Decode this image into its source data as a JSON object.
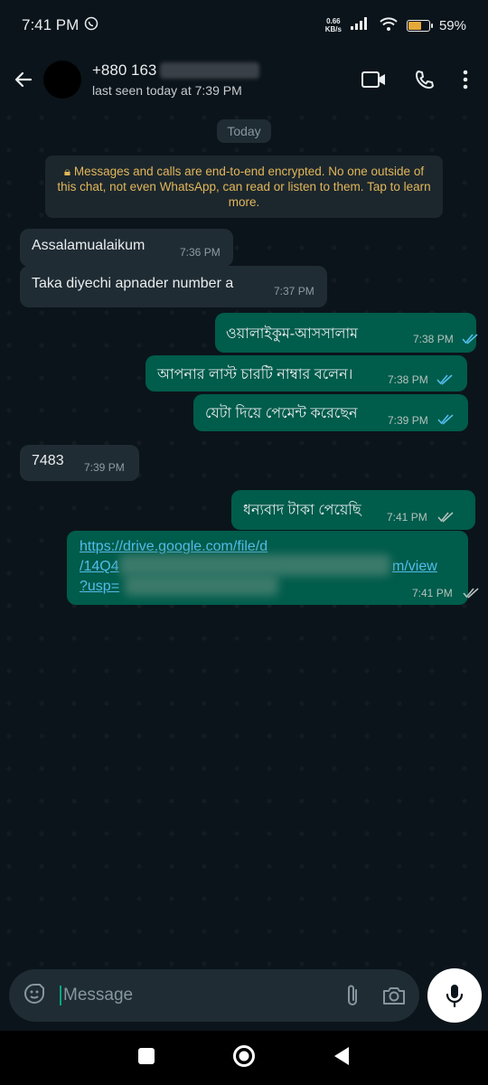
{
  "status": {
    "time": "7:41 PM",
    "speed_top": "0.66",
    "speed_bottom": "KB/s",
    "battery": "59%"
  },
  "header": {
    "phone": "+880 163",
    "last_seen": "last seen today at 7:39 PM"
  },
  "chat": {
    "day": "Today",
    "encryption": "Messages and calls are end-to-end encrypted. No one outside of this chat, not even WhatsApp, can read or listen to them. Tap to learn more.",
    "messages": [
      {
        "text": "Assalamualaikum",
        "time": "7:36 PM"
      },
      {
        "text": "Taka diyechi apnader number a",
        "time": "7:37 PM"
      },
      {
        "text": "ওয়ালাইকুম-আসসালাম",
        "time": "7:38 PM"
      },
      {
        "text": "আপনার লাস্ট চারটি নাম্বার বলেন।",
        "time": "7:38 PM"
      },
      {
        "text": "যেটা দিয়ে পেমেন্ট করেছেন",
        "time": "7:39 PM"
      },
      {
        "text": "7483",
        "time": "7:39 PM"
      },
      {
        "text": "ধন্যবাদ টাকা পেয়েছি",
        "time": "7:41 PM"
      },
      {
        "link_line1": "https://drive.google.com/file/d",
        "link_line2_start": "/14Q4",
        "link_line2_end": "m/view",
        "link_line3": "?usp=",
        "time": "7:41 PM"
      }
    ]
  },
  "composer": {
    "placeholder": "Message"
  },
  "colors": {
    "accent": "#00a884",
    "read_ticks": "#53bdeb",
    "outgoing_bubble": "#005c4b",
    "incoming_bubble": "#202c33"
  }
}
